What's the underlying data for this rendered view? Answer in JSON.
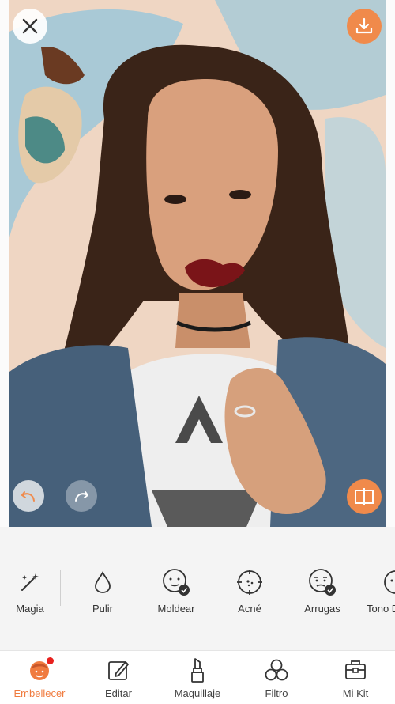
{
  "tools": [
    {
      "label": "Magia",
      "icon": "magic-wand-icon"
    },
    {
      "label": "Pulir",
      "icon": "drop-icon"
    },
    {
      "label": "Moldear",
      "icon": "reshape-face-icon"
    },
    {
      "label": "Acné",
      "icon": "acne-target-icon"
    },
    {
      "label": "Arrugas",
      "icon": "wrinkles-face-icon"
    },
    {
      "label": "Tono D",
      "icon": "skin-tone-icon"
    }
  ],
  "tabs": [
    {
      "label": "Embellecer",
      "icon": "beautify-face-icon",
      "active": true
    },
    {
      "label": "Editar",
      "icon": "edit-pencil-icon",
      "active": false
    },
    {
      "label": "Maquillaje",
      "icon": "lipstick-icon",
      "active": false
    },
    {
      "label": "Filtro",
      "icon": "filter-circles-icon",
      "active": false
    },
    {
      "label": "Mi Kit",
      "icon": "kit-bag-icon",
      "active": false
    }
  ],
  "colors": {
    "accent": "#f08a4b",
    "active_tab": "#f07b3f",
    "badge": "#e8211e"
  }
}
